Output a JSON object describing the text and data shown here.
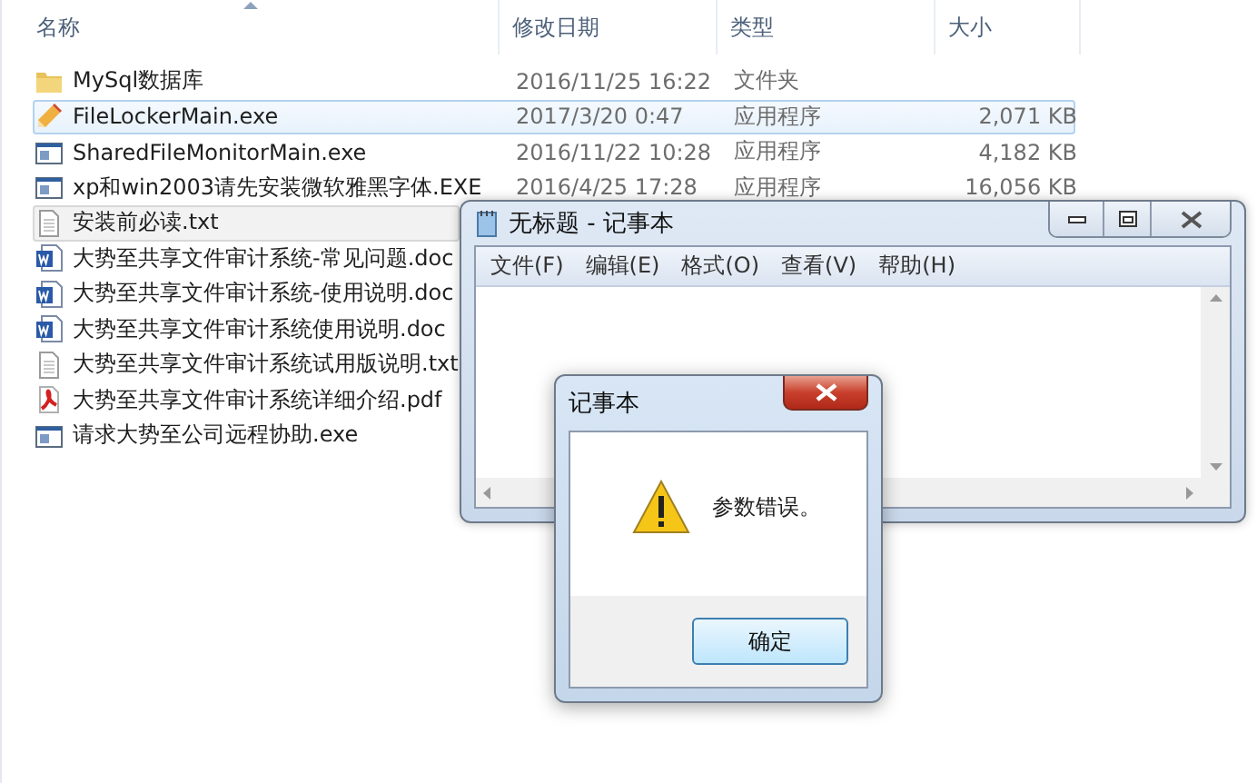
{
  "explorer": {
    "columns": [
      {
        "label": "名称",
        "sorted": true
      },
      {
        "label": "修改日期",
        "sorted": false
      },
      {
        "label": "类型",
        "sorted": false
      },
      {
        "label": "大小",
        "sorted": false
      }
    ],
    "rows": [
      {
        "kind": "folder",
        "name": "MySql数据库",
        "date": "2016/11/25 16:22",
        "type": "文件夹",
        "selected": false,
        "hovered": false
      },
      {
        "kind": "locker",
        "name": "FileLockerMain.exe",
        "date": "2017/3/20 0:47",
        "type": "应用程序",
        "size": "2,071 KB",
        "selected": true,
        "hovered": false
      },
      {
        "kind": "app",
        "name": "SharedFileMonitorMain.exe",
        "date": "2016/11/22 10:28",
        "type": "应用程序",
        "size": "4,182 KB",
        "selected": false,
        "hovered": false
      },
      {
        "kind": "app",
        "name": "xp和win2003请先安装微软雅黑字体.EXE",
        "date": "2016/4/25 17:28",
        "type": "应用程序",
        "size": "16,056 KB",
        "selected": false,
        "hovered": false
      },
      {
        "kind": "text",
        "name": "安装前必读.txt",
        "selected": false,
        "hovered": true
      },
      {
        "kind": "word",
        "name": "大势至共享文件审计系统-常见问题.doc",
        "selected": false,
        "hovered": false
      },
      {
        "kind": "word",
        "name": "大势至共享文件审计系统-使用说明.doc",
        "selected": false,
        "hovered": false
      },
      {
        "kind": "word",
        "name": "大势至共享文件审计系统使用说明.doc",
        "selected": false,
        "hovered": false
      },
      {
        "kind": "text",
        "name": "大势至共享文件审计系统试用版说明.txt",
        "selected": false,
        "hovered": false
      },
      {
        "kind": "pdf",
        "name": "大势至共享文件审计系统详细介绍.pdf",
        "selected": false,
        "hovered": false
      },
      {
        "kind": "app",
        "name": "请求大势至公司远程协助.exe",
        "selected": false,
        "hovered": false
      }
    ]
  },
  "notepad": {
    "title": "无标题 - 记事本",
    "menu": [
      "文件(F)",
      "编辑(E)",
      "格式(O)",
      "查看(V)",
      "帮助(H)"
    ]
  },
  "dialog": {
    "title": "记事本",
    "message": "参数错误。",
    "buttons": [
      "确定"
    ]
  }
}
